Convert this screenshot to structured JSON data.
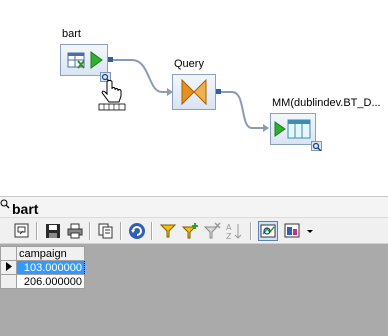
{
  "canvas": {
    "source_node": {
      "label": "bart"
    },
    "query_node": {
      "label": "Query"
    },
    "target_node": {
      "label": "MM(dublindev.BT_D..."
    }
  },
  "panel": {
    "title": "bart",
    "toolbar": [
      {
        "icon": "options-icon"
      },
      {
        "icon": "save-icon"
      },
      {
        "icon": "print-icon"
      },
      {
        "icon": "copy-icon"
      },
      {
        "icon": "refresh-icon"
      },
      {
        "icon": "filter-icon"
      },
      {
        "icon": "add-filter-icon"
      },
      {
        "icon": "remove-filter-icon"
      },
      {
        "icon": "sort-icon"
      },
      {
        "icon": "show-profile-icon"
      },
      {
        "icon": "view-options-icon"
      }
    ],
    "grid": {
      "columns": [
        "campaign"
      ],
      "rows": [
        {
          "campaign": "103.000000",
          "selected": true
        },
        {
          "campaign": "206.000000",
          "selected": false
        }
      ]
    }
  },
  "colors": {
    "selection": "#3399ff",
    "grid_background": "#aaaaaa",
    "connector": "#8a9bb5",
    "query_bowtie": "#e8901c",
    "play_green": "#2fb02f"
  }
}
